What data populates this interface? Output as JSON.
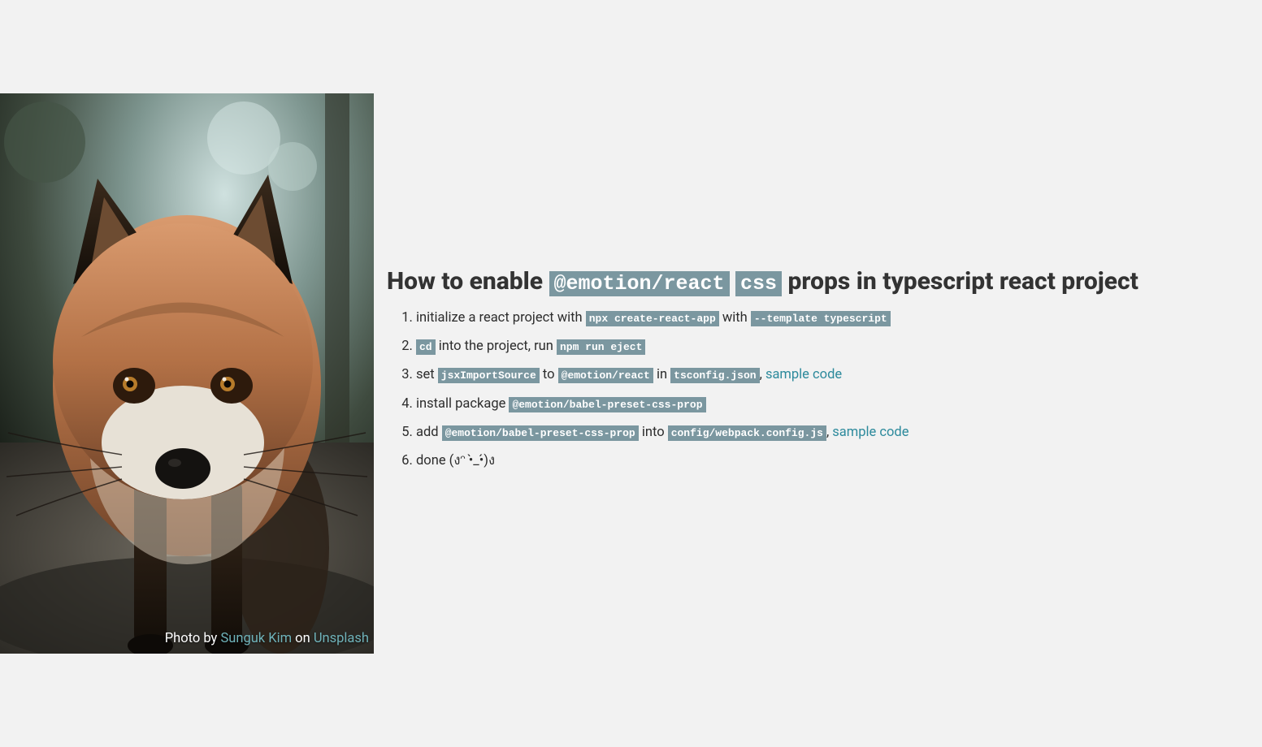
{
  "hero": {
    "credit_prefix": "Photo by ",
    "credit_author": "Sunguk Kim",
    "credit_mid": " on ",
    "credit_site": "Unsplash"
  },
  "heading": {
    "pre": "How to enable ",
    "code1": "@emotion/react",
    "code2": "css",
    "post": " props in typescript react project"
  },
  "steps": {
    "s1": {
      "t1": "initialize a react project with ",
      "c1": "npx create-react-app",
      "t2": " with ",
      "c2": "--template typescript"
    },
    "s2": {
      "c1": "cd",
      "t1": " into the project, run ",
      "c2": "npm run eject"
    },
    "s3": {
      "t1": "set ",
      "c1": "jsxImportSource",
      "t2": " to ",
      "c2": "@emotion/react",
      "t3": " in ",
      "c3": "tsconfig.json",
      "t4": ", ",
      "link": "sample code"
    },
    "s4": {
      "t1": "install package ",
      "c1": "@emotion/babel-preset-css-prop"
    },
    "s5": {
      "t1": "add ",
      "c1": "@emotion/babel-preset-css-prop",
      "t2": " into ",
      "c2": "config/webpack.config.js",
      "t3": ", ",
      "link": "sample code"
    },
    "s6": {
      "t1": "done (งᵔ •̀_•́)ง"
    }
  }
}
